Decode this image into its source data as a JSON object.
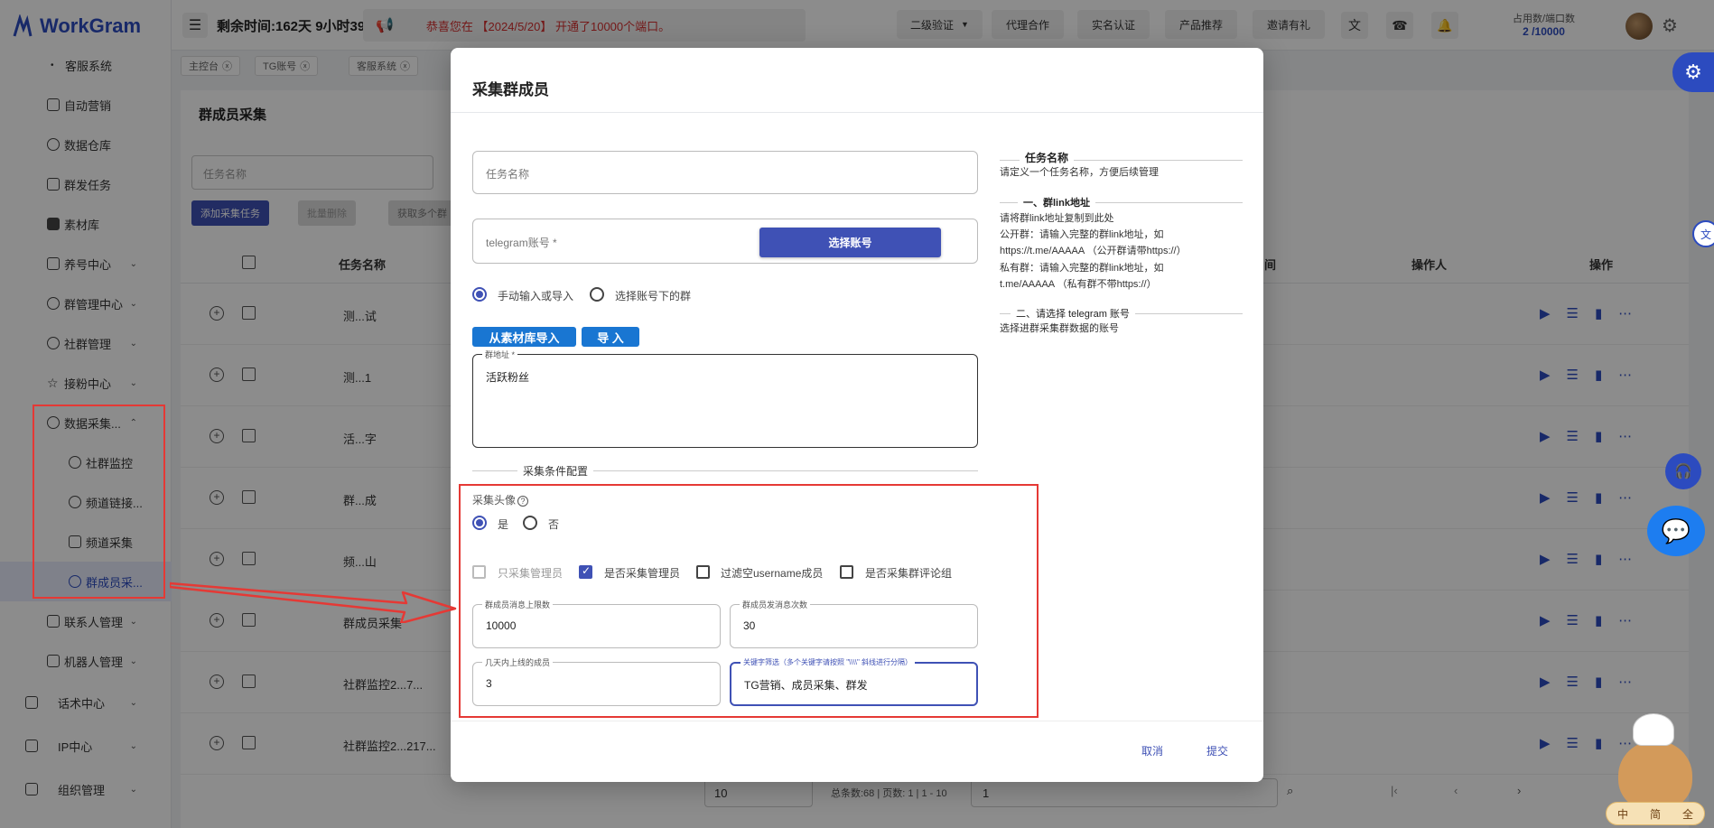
{
  "app": {
    "logo": "WorkGram"
  },
  "topbar": {
    "remain": "剩余时间:162天 9小时39",
    "notice": "恭喜您在 【2024/5/20】 开通了10000个端口。",
    "buttons": [
      "二级验证",
      "代理合作",
      "实名认证",
      "产品推荐",
      "邀请有礼"
    ],
    "usage_label": "占用数/端口数",
    "usage_value": "2 /10000"
  },
  "tabs": [
    "主控台",
    "TG账号",
    "客服系统"
  ],
  "sidebar": {
    "items": [
      {
        "label": "客服系统",
        "icon": "dot-icon"
      },
      {
        "label": "自动营销",
        "icon": "megaphone-icon"
      },
      {
        "label": "数据仓库",
        "icon": "database-icon"
      },
      {
        "label": "群发任务",
        "icon": "send-icon"
      },
      {
        "label": "素材库",
        "icon": "folder-icon"
      },
      {
        "label": "养号中心",
        "icon": "id-card-icon"
      },
      {
        "label": "群管理中心",
        "icon": "group-icon"
      },
      {
        "label": "社群管理",
        "icon": "community-icon"
      },
      {
        "label": "接粉中心",
        "icon": "star-icon"
      },
      {
        "label": "数据采集...",
        "icon": "chart-pie-icon"
      },
      {
        "label": "社群监控",
        "icon": "eye-icon"
      },
      {
        "label": "频道链接...",
        "icon": "link-icon"
      },
      {
        "label": "频道采集",
        "icon": "checkbox-icon"
      },
      {
        "label": "群成员采...",
        "icon": "members-icon"
      },
      {
        "label": "联系人管理",
        "icon": "contacts-icon"
      },
      {
        "label": "机器人管理",
        "icon": "robot-icon"
      },
      {
        "label": "话术中心",
        "icon": "script-icon"
      },
      {
        "label": "IP中心",
        "icon": "server-icon"
      },
      {
        "label": "组织管理",
        "icon": "grid-icon"
      }
    ]
  },
  "page": {
    "title": "群成员采集",
    "filter_placeholder": "任务名称",
    "add_btn": "添加采集任务",
    "batch_delete": "批量删除",
    "fetch_btn": "获取多个群",
    "columns": {
      "name": "任务名称",
      "time": "间",
      "operator": "操作人",
      "actions": "操作"
    },
    "rows": [
      "测...试",
      "测...1",
      "活...字",
      "群...成",
      "频...山",
      "群成员采集",
      "社群监控2...7...",
      "社群监控2...217..."
    ],
    "pager": {
      "page_size": "10",
      "summary": "总条数:68 | 页数: 1 | 1 - 10",
      "page": "1"
    }
  },
  "modal": {
    "title": "采集群成员",
    "task_name_placeholder": "任务名称",
    "account_label": "telegram账号 *",
    "select_account_btn": "选择账号",
    "mode_manual": "手动输入或导入",
    "mode_select": "选择账号下的群",
    "import_from_lib": "从素材库导入",
    "import": "导 入",
    "group_addr_label": "群地址 *",
    "group_addr_value": "活跃粉丝",
    "section_title": "采集条件配置",
    "avatar_label": "采集头像",
    "yes": "是",
    "no": "否",
    "checks": [
      "只采集管理员",
      "是否采集管理员",
      "过滤空username成员",
      "是否采集群评论组"
    ],
    "max_msg_label": "群成员消息上限数",
    "max_msg_value": "10000",
    "min_msg_label": "群成员发消息次数",
    "min_msg_value": "30",
    "online_days_label": "几天内上线的成员",
    "online_days_value": "3",
    "keyword_label": "关键字筛选（多个关键字请按照 \"\\\\\\\\\" 斜线进行分隔）",
    "keyword_value": "TG营销、成员采集、群发",
    "cancel": "取消",
    "submit": "提交"
  },
  "hints": {
    "task_title": "任务名称",
    "task_desc": "请定义一个任务名称，方便后续管理",
    "link_title": "一、群link地址",
    "link_desc_1": "请将群link地址复制到此处",
    "link_desc_2": "公开群：请输入完整的群link地址，如",
    "link_desc_3": "https://t.me/AAAAA （公开群请带https://）",
    "link_desc_4": "私有群：请输入完整的群link地址，如",
    "link_desc_5": "t.me/AAAAA （私有群不带https://）",
    "account_title": "二、请选择 telegram 账号",
    "account_desc": "选择进群采集群数据的账号"
  },
  "mascot": {
    "chars": [
      "中",
      "简",
      "全"
    ]
  },
  "colors": {
    "primary": "#3f51b5",
    "brand": "#2c4bbf",
    "annotation_red": "#e53935",
    "notice_red": "#d32f2f"
  }
}
